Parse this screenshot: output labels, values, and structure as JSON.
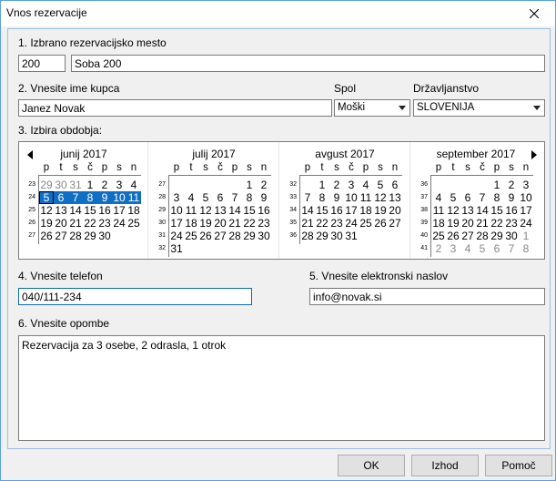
{
  "window": {
    "title": "Vnos rezervacije"
  },
  "place": {
    "label": "1. Izbrano rezervacijsko mesto",
    "code": "200",
    "name": "Soba 200"
  },
  "customer": {
    "label": "2. Vnesite ime kupca",
    "name": "Janez Novak"
  },
  "gender": {
    "label": "Spol",
    "value": "Moški"
  },
  "citizenship": {
    "label": "Državljanstvo",
    "value": "SLOVENIJA"
  },
  "period": {
    "label": "3. Izbira obdobja:"
  },
  "calendar": {
    "weekdays": [
      "p",
      "t",
      "s",
      "č",
      "p",
      "s",
      "n"
    ],
    "months": [
      {
        "title": "junij 2017",
        "weeks": [
          "23",
          "24",
          "25",
          "26",
          "27"
        ],
        "rows": [
          [
            {
              "d": "29",
              "o": true
            },
            {
              "d": "30",
              "o": true
            },
            {
              "d": "31",
              "o": true
            },
            {
              "d": "1"
            },
            {
              "d": "2"
            },
            {
              "d": "3"
            },
            {
              "d": "4"
            }
          ],
          [
            {
              "d": "5",
              "s": true,
              "t": true
            },
            {
              "d": "6",
              "s": true
            },
            {
              "d": "7",
              "s": true
            },
            {
              "d": "8",
              "s": true
            },
            {
              "d": "9",
              "s": true
            },
            {
              "d": "10",
              "s": true
            },
            {
              "d": "11",
              "s": true
            }
          ],
          [
            {
              "d": "12"
            },
            {
              "d": "13"
            },
            {
              "d": "14"
            },
            {
              "d": "15"
            },
            {
              "d": "16"
            },
            {
              "d": "17"
            },
            {
              "d": "18"
            }
          ],
          [
            {
              "d": "19"
            },
            {
              "d": "20"
            },
            {
              "d": "21"
            },
            {
              "d": "22"
            },
            {
              "d": "23"
            },
            {
              "d": "24"
            },
            {
              "d": "25"
            }
          ],
          [
            {
              "d": "26"
            },
            {
              "d": "27"
            },
            {
              "d": "28"
            },
            {
              "d": "29"
            },
            {
              "d": "30"
            },
            {
              "d": ""
            },
            {
              "d": ""
            }
          ]
        ]
      },
      {
        "title": "julij 2017",
        "weeks": [
          "27",
          "28",
          "29",
          "30",
          "31",
          "32"
        ],
        "rows": [
          [
            {
              "d": ""
            },
            {
              "d": ""
            },
            {
              "d": ""
            },
            {
              "d": ""
            },
            {
              "d": ""
            },
            {
              "d": "1"
            },
            {
              "d": "2"
            }
          ],
          [
            {
              "d": "3"
            },
            {
              "d": "4"
            },
            {
              "d": "5"
            },
            {
              "d": "6"
            },
            {
              "d": "7"
            },
            {
              "d": "8"
            },
            {
              "d": "9"
            }
          ],
          [
            {
              "d": "10"
            },
            {
              "d": "11"
            },
            {
              "d": "12"
            },
            {
              "d": "13"
            },
            {
              "d": "14"
            },
            {
              "d": "15"
            },
            {
              "d": "16"
            }
          ],
          [
            {
              "d": "17"
            },
            {
              "d": "18"
            },
            {
              "d": "19"
            },
            {
              "d": "20"
            },
            {
              "d": "21"
            },
            {
              "d": "22"
            },
            {
              "d": "23"
            }
          ],
          [
            {
              "d": "24"
            },
            {
              "d": "25"
            },
            {
              "d": "26"
            },
            {
              "d": "27"
            },
            {
              "d": "28"
            },
            {
              "d": "29"
            },
            {
              "d": "30"
            }
          ],
          [
            {
              "d": "31"
            },
            {
              "d": ""
            },
            {
              "d": ""
            },
            {
              "d": ""
            },
            {
              "d": ""
            },
            {
              "d": ""
            },
            {
              "d": ""
            }
          ]
        ]
      },
      {
        "title": "avgust 2017",
        "weeks": [
          "32",
          "33",
          "34",
          "35",
          "36"
        ],
        "rows": [
          [
            {
              "d": ""
            },
            {
              "d": "1"
            },
            {
              "d": "2"
            },
            {
              "d": "3"
            },
            {
              "d": "4"
            },
            {
              "d": "5"
            },
            {
              "d": "6"
            }
          ],
          [
            {
              "d": "7"
            },
            {
              "d": "8"
            },
            {
              "d": "9"
            },
            {
              "d": "10"
            },
            {
              "d": "11"
            },
            {
              "d": "12"
            },
            {
              "d": "13"
            }
          ],
          [
            {
              "d": "14"
            },
            {
              "d": "15"
            },
            {
              "d": "16"
            },
            {
              "d": "17"
            },
            {
              "d": "18"
            },
            {
              "d": "19"
            },
            {
              "d": "20"
            }
          ],
          [
            {
              "d": "21"
            },
            {
              "d": "22"
            },
            {
              "d": "23"
            },
            {
              "d": "24"
            },
            {
              "d": "25"
            },
            {
              "d": "26"
            },
            {
              "d": "27"
            }
          ],
          [
            {
              "d": "28"
            },
            {
              "d": "29"
            },
            {
              "d": "30"
            },
            {
              "d": "31"
            },
            {
              "d": ""
            },
            {
              "d": ""
            },
            {
              "d": ""
            }
          ]
        ]
      },
      {
        "title": "september 2017",
        "weeks": [
          "36",
          "37",
          "38",
          "39",
          "40",
          "41"
        ],
        "rows": [
          [
            {
              "d": ""
            },
            {
              "d": ""
            },
            {
              "d": ""
            },
            {
              "d": ""
            },
            {
              "d": "1"
            },
            {
              "d": "2"
            },
            {
              "d": "3"
            }
          ],
          [
            {
              "d": "4"
            },
            {
              "d": "5"
            },
            {
              "d": "6"
            },
            {
              "d": "7"
            },
            {
              "d": "8"
            },
            {
              "d": "9"
            },
            {
              "d": "10"
            }
          ],
          [
            {
              "d": "11"
            },
            {
              "d": "12"
            },
            {
              "d": "13"
            },
            {
              "d": "14"
            },
            {
              "d": "15"
            },
            {
              "d": "16"
            },
            {
              "d": "17"
            }
          ],
          [
            {
              "d": "18"
            },
            {
              "d": "19"
            },
            {
              "d": "20"
            },
            {
              "d": "21"
            },
            {
              "d": "22"
            },
            {
              "d": "23"
            },
            {
              "d": "24"
            }
          ],
          [
            {
              "d": "25"
            },
            {
              "d": "26"
            },
            {
              "d": "27"
            },
            {
              "d": "28"
            },
            {
              "d": "29"
            },
            {
              "d": "30"
            },
            {
              "d": "1",
              "o": true
            }
          ],
          [
            {
              "d": "2",
              "o": true
            },
            {
              "d": "3",
              "o": true
            },
            {
              "d": "4",
              "o": true
            },
            {
              "d": "5",
              "o": true
            },
            {
              "d": "6",
              "o": true
            },
            {
              "d": "7",
              "o": true
            },
            {
              "d": "8",
              "o": true
            }
          ]
        ]
      }
    ]
  },
  "phone": {
    "label": "4. Vnesite telefon",
    "value": "040/111-234"
  },
  "email": {
    "label": "5. Vnesite elektronski naslov",
    "value": "info@novak.si"
  },
  "notes": {
    "label": "6. Vnesite opombe",
    "value": "Rezervacija za 3 osebe, 2 odrasla, 1 otrok"
  },
  "buttons": {
    "ok": "OK",
    "cancel": "Izhod",
    "help": "Pomoč"
  },
  "colors": {
    "selection": "#0e6fc4",
    "focus_border": "#0a6aa8",
    "window_border": "#5aa0e0"
  }
}
